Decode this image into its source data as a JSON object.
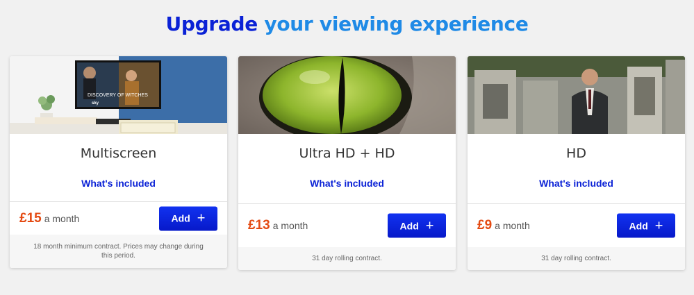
{
  "headline": {
    "strong": "Upgrade",
    "light": " your viewing experience"
  },
  "tv_show_title": "DISCOVERY OF WITCHES",
  "tv_show_brand": "sky",
  "cards": [
    {
      "title": "Multiscreen",
      "whats_included": "What's included",
      "price": "£15",
      "per": "a month",
      "add_label": "Add",
      "add_icon": "+",
      "footer": "18 month minimum contract. Prices may change during this period."
    },
    {
      "title": "Ultra HD + HD",
      "whats_included": "What's included",
      "price": "£13",
      "per": "a month",
      "add_label": "Add",
      "add_icon": "+",
      "footer": "31 day rolling contract."
    },
    {
      "title": "HD",
      "whats_included": "What's included",
      "price": "£9",
      "per": "a month",
      "add_label": "Add",
      "add_icon": "+",
      "footer": "31 day rolling contract."
    }
  ],
  "colors": {
    "brand_blue": "#0b22d6",
    "headline_light": "#1f8ae6",
    "price_orange": "#e44a12"
  }
}
